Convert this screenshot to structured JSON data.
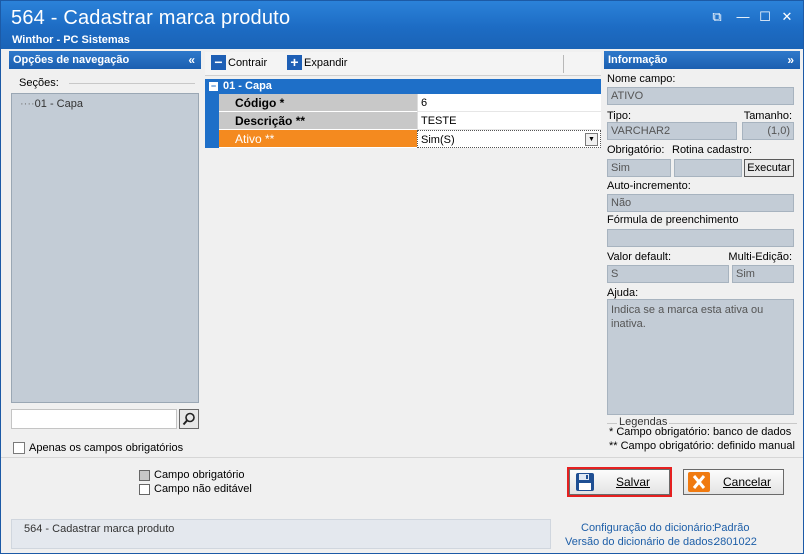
{
  "window": {
    "title": "564 - Cadastrar marca produto",
    "subtitle": "Winthor - PC Sistemas",
    "controls": {
      "restore": "⧉",
      "minimize": "—",
      "maximize": "☐",
      "close": "✕"
    }
  },
  "nav": {
    "header": "Opções de navegação",
    "collapse_icon": "«",
    "sections_label": "Seções:",
    "tree": [
      "01 - Capa"
    ],
    "search_value": "",
    "only_required_label": "Apenas os campos obrigatórios"
  },
  "toolbar": {
    "collapse_label": "Contrair",
    "expand_label": "Expandir"
  },
  "grid": {
    "category": "01 - Capa",
    "rows": [
      {
        "name": "Código *",
        "value": "6"
      },
      {
        "name": "Descrição **",
        "value": "TESTE"
      },
      {
        "name": "Ativo **",
        "value": "Sim(S)"
      }
    ]
  },
  "info": {
    "header": "Informação",
    "expand_icon": "»",
    "field_name_label": "Nome campo:",
    "field_name_value": "ATIVO",
    "type_label": "Tipo:",
    "type_value": "VARCHAR2",
    "size_label": "Tamanho:",
    "size_value": "(1,0)",
    "required_label": "Obrigatório:",
    "required_value": "Sim",
    "routine_label": "Rotina cadastro:",
    "execute_label": "Executar",
    "auto_increment_label": "Auto-incremento:",
    "auto_increment_value": "Não",
    "formula_label": "Fórmula de preenchimento",
    "formula_value": "",
    "default_label": "Valor default:",
    "default_value": "S",
    "multi_edit_label": "Multi-Edição:",
    "multi_edit_value": "Sim",
    "help_label": "Ajuda:",
    "help_text": "Indica se a marca esta ativa ou inativa.",
    "legend_title": "Legendas",
    "legend_1": "* Campo obrigatório: banco de dados",
    "legend_2": "** Campo obrigatório: definido manual"
  },
  "bottom": {
    "legend_required": "Campo obrigatório",
    "legend_not_editable": "Campo não editável",
    "save_label": "Salvar",
    "cancel_label": "Cancelar"
  },
  "status": {
    "left_text": "564 - Cadastrar marca produto",
    "config_label": "Configuração do dicionário:",
    "config_value": "Padrão",
    "version_label": "Versão do dicionário de dados:",
    "version_value": "2801022"
  },
  "colors": {
    "title_bar": "#1d6cc4",
    "category": "#1e6fc8",
    "active_row": "#f48a1f",
    "readonly_field": "#c3ccd6",
    "save_highlight": "#e52020",
    "cancel_icon": "#f07a10"
  }
}
